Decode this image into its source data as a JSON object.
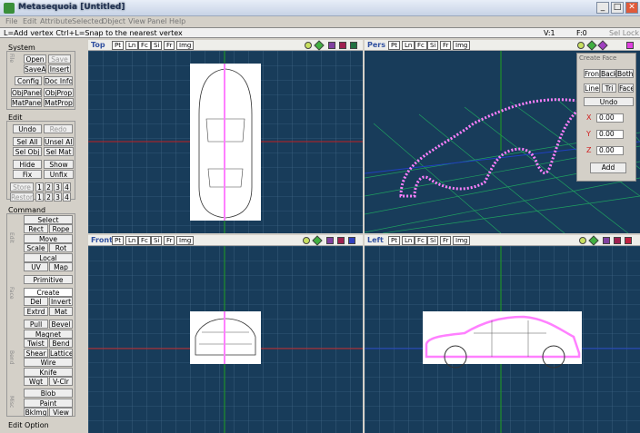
{
  "window": {
    "title": "Metasequoia [Untitled]",
    "min": "_",
    "max": "□",
    "close": "✕"
  },
  "menu": [
    "File",
    "Edit",
    "Attribute",
    "Selected",
    "Object",
    "View",
    "Panel",
    "Help"
  ],
  "status": {
    "hint": "L=Add vertex  Ctrl+L=Snap to the nearest vertex",
    "v": "V:1",
    "f": "F:0",
    "sel_lock": "Sel Lock"
  },
  "sidebar": {
    "system": {
      "title": "System",
      "open": "Open",
      "save": "Save",
      "saveas": "SaveAs",
      "insert": "Insert",
      "config": "Config",
      "docinfo": "Doc Info",
      "objpanel": "ObjPanel",
      "objprop": "ObjProp",
      "matpanel": "MatPanel",
      "matprop": "MatProp"
    },
    "edit": {
      "title": "Edit",
      "undo": "Undo",
      "redo": "Redo",
      "selall": "Sel All",
      "unselall": "Unsel All",
      "selobj": "Sel Obj",
      "selmat": "Sel Mat",
      "hide": "Hide",
      "show": "Show",
      "fix": "Fix",
      "unfix": "Unfix",
      "store": "Store",
      "restore": "Restore",
      "n1": "1",
      "n2": "2",
      "n3": "3",
      "n4": "4"
    },
    "command": {
      "title": "Command",
      "select": "Select",
      "rect": "Rect",
      "rope": "Rope",
      "move": "Move",
      "scale": "Scale",
      "rot": "Rot",
      "local": "Local",
      "uv": "UV",
      "map": "Map",
      "primitive": "Primitive",
      "create": "Create",
      "del": "Del",
      "invert": "Invert",
      "extrd": "Extrd",
      "mat": "Mat",
      "pull": "Pull",
      "bevel": "Bevel",
      "magnet": "Magnet",
      "twist": "Twist",
      "bend": "Bend",
      "shear": "Shear",
      "lattice": "Lattice",
      "wire": "Wire",
      "knife": "Knife",
      "wgt": "Wgt",
      "vclr": "V-Clr",
      "blob": "Blob",
      "paint": "Paint",
      "bkimg": "BkImg",
      "view": "View"
    },
    "vlabels": {
      "file": "File",
      "edit": "Edit",
      "face": "Face",
      "bend": "Bend",
      "misc": "Misc"
    },
    "editoption": "Edit Option"
  },
  "viewports": {
    "top": {
      "name": "Top"
    },
    "pers": {
      "name": "Pers"
    },
    "front": {
      "name": "Front"
    },
    "left": {
      "name": "Left"
    },
    "tabs": [
      "Pt",
      "Ln",
      "Fc",
      "Si",
      "Fr",
      "Img"
    ]
  },
  "create_face": {
    "title": "Create Face",
    "front": "Front",
    "back": "Back",
    "both": "Both",
    "line": "Line",
    "tri": "Tri",
    "face": "Face",
    "undo": "Undo",
    "x_label": "X",
    "y_label": "Y",
    "z_label": "Z",
    "x": "0.00",
    "y": "0.00",
    "z": "0.00",
    "add": "Add"
  },
  "colors": {
    "viewport_bg": "#183c5a",
    "accent_pink": "#ff80ff"
  }
}
